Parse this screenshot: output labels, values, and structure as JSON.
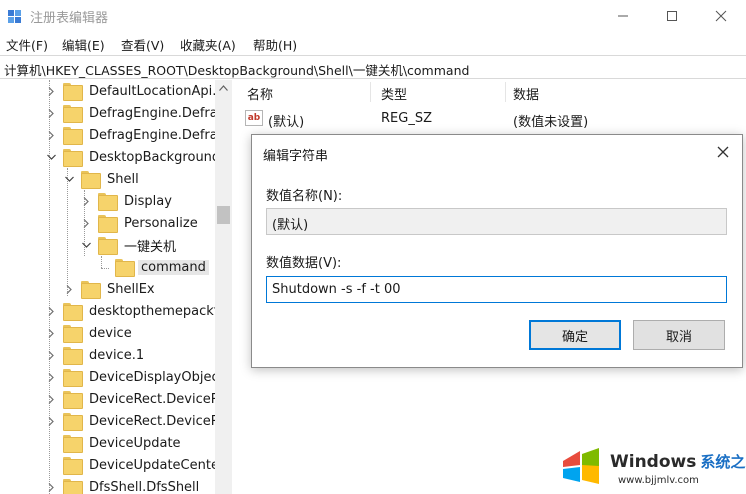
{
  "window": {
    "title": "注册表编辑器",
    "icon": "regedit-icon",
    "controls": [
      "minimize-icon",
      "maximize-icon",
      "close-icon"
    ]
  },
  "menu": {
    "items": [
      "文件(F)",
      "编辑(E)",
      "查看(V)",
      "收藏夹(A)",
      "帮助(H)"
    ]
  },
  "address": {
    "path": "计算机\\HKEY_CLASSES_ROOT\\DesktopBackground\\Shell\\一键关机\\command"
  },
  "tree": {
    "items": [
      {
        "label": "DefaultLocationApi.1",
        "expander": "collapsed"
      },
      {
        "label": "DefragEngine.Defrag",
        "expander": "collapsed"
      },
      {
        "label": "DefragEngine.Defrag",
        "expander": "collapsed"
      },
      {
        "label": "DesktopBackground",
        "expander": "expanded"
      },
      {
        "label": "Shell",
        "expander": "expanded"
      },
      {
        "label": "Display",
        "expander": "collapsed"
      },
      {
        "label": "Personalize",
        "expander": "collapsed"
      },
      {
        "label": "一键关机",
        "expander": "expanded"
      },
      {
        "label": "command",
        "expander": "none",
        "selected": true
      },
      {
        "label": "ShellEx",
        "expander": "collapsed"
      },
      {
        "label": "desktopthemepackfil",
        "expander": "collapsed"
      },
      {
        "label": "device",
        "expander": "collapsed"
      },
      {
        "label": "device.1",
        "expander": "collapsed"
      },
      {
        "label": "DeviceDisplayObject",
        "expander": "collapsed"
      },
      {
        "label": "DeviceRect.DeviceRec",
        "expander": "collapsed"
      },
      {
        "label": "DeviceRect.DeviceRec",
        "expander": "collapsed"
      },
      {
        "label": "DeviceUpdate",
        "expander": "none"
      },
      {
        "label": "DeviceUpdateCenter",
        "expander": "none"
      },
      {
        "label": "DfsShell.DfsShell",
        "expander": "collapsed"
      }
    ]
  },
  "list": {
    "columns": [
      "名称",
      "类型",
      "数据"
    ],
    "rows": [
      {
        "icon": "ab",
        "name": "(默认)",
        "type": "REG_SZ",
        "data": "(数值未设置)"
      }
    ]
  },
  "dialog": {
    "title": "编辑字符串",
    "name_label": "数值名称(N):",
    "name_value": "(默认)",
    "data_label": "数值数据(V):",
    "data_value": "Shutdown -s -f -t 00",
    "ok_label": "确定",
    "cancel_label": "取消",
    "accent": "#0078d7"
  },
  "watermark": {
    "brand": "Windows",
    "brand_suffix": "系统之家",
    "url": "www.bjjmlv.com"
  }
}
